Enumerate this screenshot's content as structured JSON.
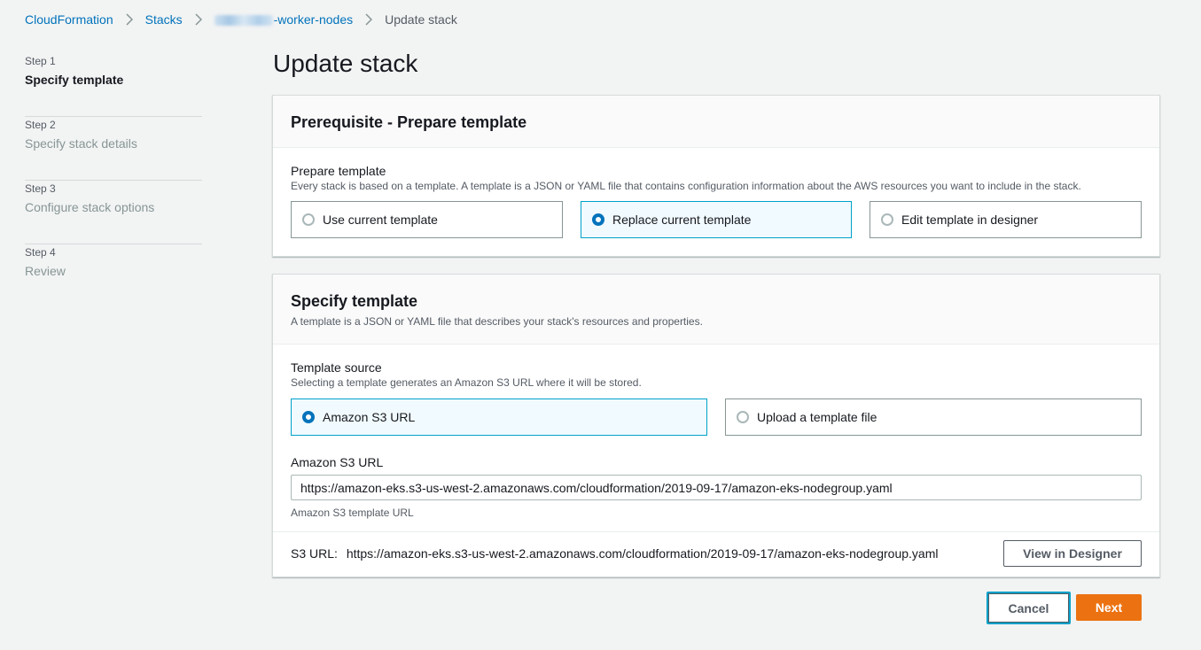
{
  "breadcrumb": {
    "items": [
      "CloudFormation",
      "Stacks",
      "-worker-nodes",
      "Update stack"
    ]
  },
  "steps": [
    {
      "num": "Step 1",
      "label": "Specify template"
    },
    {
      "num": "Step 2",
      "label": "Specify stack details"
    },
    {
      "num": "Step 3",
      "label": "Configure stack options"
    },
    {
      "num": "Step 4",
      "label": "Review"
    }
  ],
  "page_title": "Update stack",
  "prereq": {
    "title": "Prerequisite - Prepare template",
    "field_label": "Prepare template",
    "field_desc": "Every stack is based on a template. A template is a JSON or YAML file that contains configuration information about the AWS resources you want to include in the stack.",
    "options": [
      "Use current template",
      "Replace current template",
      "Edit template in designer"
    ],
    "selected": "Replace current template"
  },
  "specify": {
    "title": "Specify template",
    "desc": "A template is a JSON or YAML file that describes your stack's resources and properties.",
    "source_label": "Template source",
    "source_desc": "Selecting a template generates an Amazon S3 URL where it will be stored.",
    "options": [
      "Amazon S3 URL",
      "Upload a template file"
    ],
    "selected": "Amazon S3 URL",
    "url_label": "Amazon S3 URL",
    "url_value": "https://amazon-eks.s3-us-west-2.amazonaws.com/cloudformation/2019-09-17/amazon-eks-nodegroup.yaml",
    "url_hint": "Amazon S3 template URL",
    "s3_prefix": "S3 URL:",
    "s3_value": "https://amazon-eks.s3-us-west-2.amazonaws.com/cloudformation/2019-09-17/amazon-eks-nodegroup.yaml",
    "designer_button": "View in Designer"
  },
  "actions": {
    "cancel": "Cancel",
    "next": "Next"
  },
  "colors": {
    "link": "#0073bb",
    "primary": "#ec7211",
    "selected_border": "#00a1c9",
    "selected_bg": "#f1faff"
  }
}
